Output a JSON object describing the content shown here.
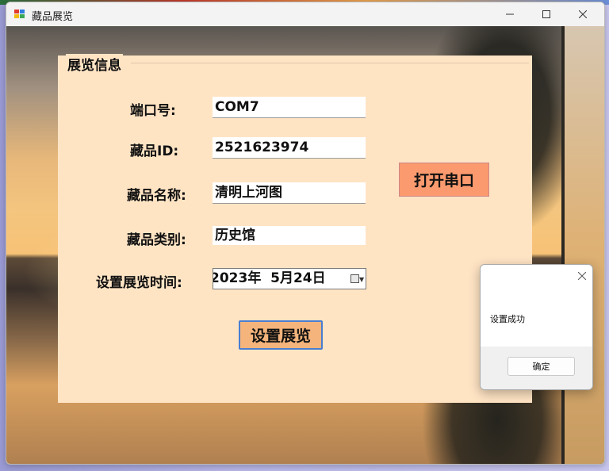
{
  "window": {
    "title": "藏品展览",
    "minimize_icon": "minimize-icon",
    "maximize_icon": "maximize-icon",
    "close_icon": "close-icon"
  },
  "group": {
    "title": "展览信息"
  },
  "form": {
    "port_label": "端口号:",
    "port_value": "COM7",
    "id_label": "藏品ID:",
    "id_value": "2521623974",
    "name_label": "藏品名称:",
    "name_value": "清明上河图",
    "category_label": "藏品类别:",
    "category_value": "历史馆",
    "time_label": "设置展览时间:",
    "time_value": "2023年  5月24日",
    "open_port_button": "打开串口",
    "set_button": "设置展览"
  },
  "messagebox": {
    "text": "设置成功",
    "ok_button": "确定",
    "close_icon": "close-icon"
  },
  "colors": {
    "panel_bg": "#ffe4c4",
    "open_button_bg": "#fa9a6e",
    "set_button_bg": "#f4b47c",
    "focus_border": "#4a7ed0"
  }
}
